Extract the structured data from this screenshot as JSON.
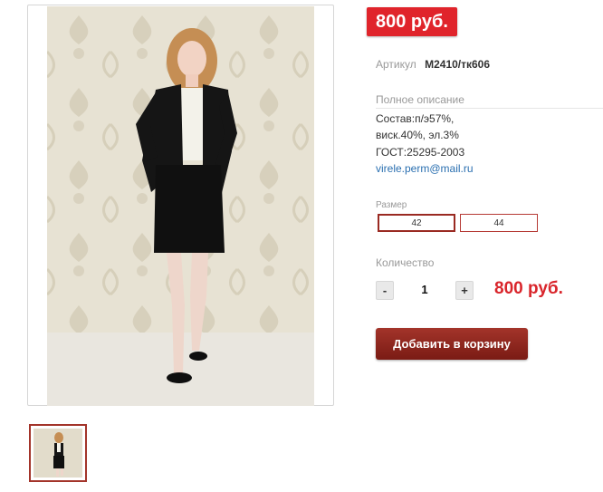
{
  "product": {
    "price_badge": "800 руб.",
    "sku": {
      "label": "Артикул",
      "value": "М2410/тк606"
    },
    "description": {
      "title": "Полное описание",
      "lines": [
        "Состав:п/э57%,",
        "виск.40%, эл.3%",
        "ГОСТ:25295-2003"
      ],
      "email": "virele.perm@mail.ru"
    },
    "size": {
      "title": "Размер",
      "options": [
        "42",
        "44"
      ],
      "selected": "42"
    },
    "quantity": {
      "title": "Количество",
      "minus": "-",
      "value": "1",
      "plus": "+"
    },
    "inline_price": "800 руб.",
    "add_to_cart": "Добавить в корзину"
  },
  "colors": {
    "accent": "#e0242b",
    "button": "#8b241c",
    "link": "#2a6fb0"
  }
}
